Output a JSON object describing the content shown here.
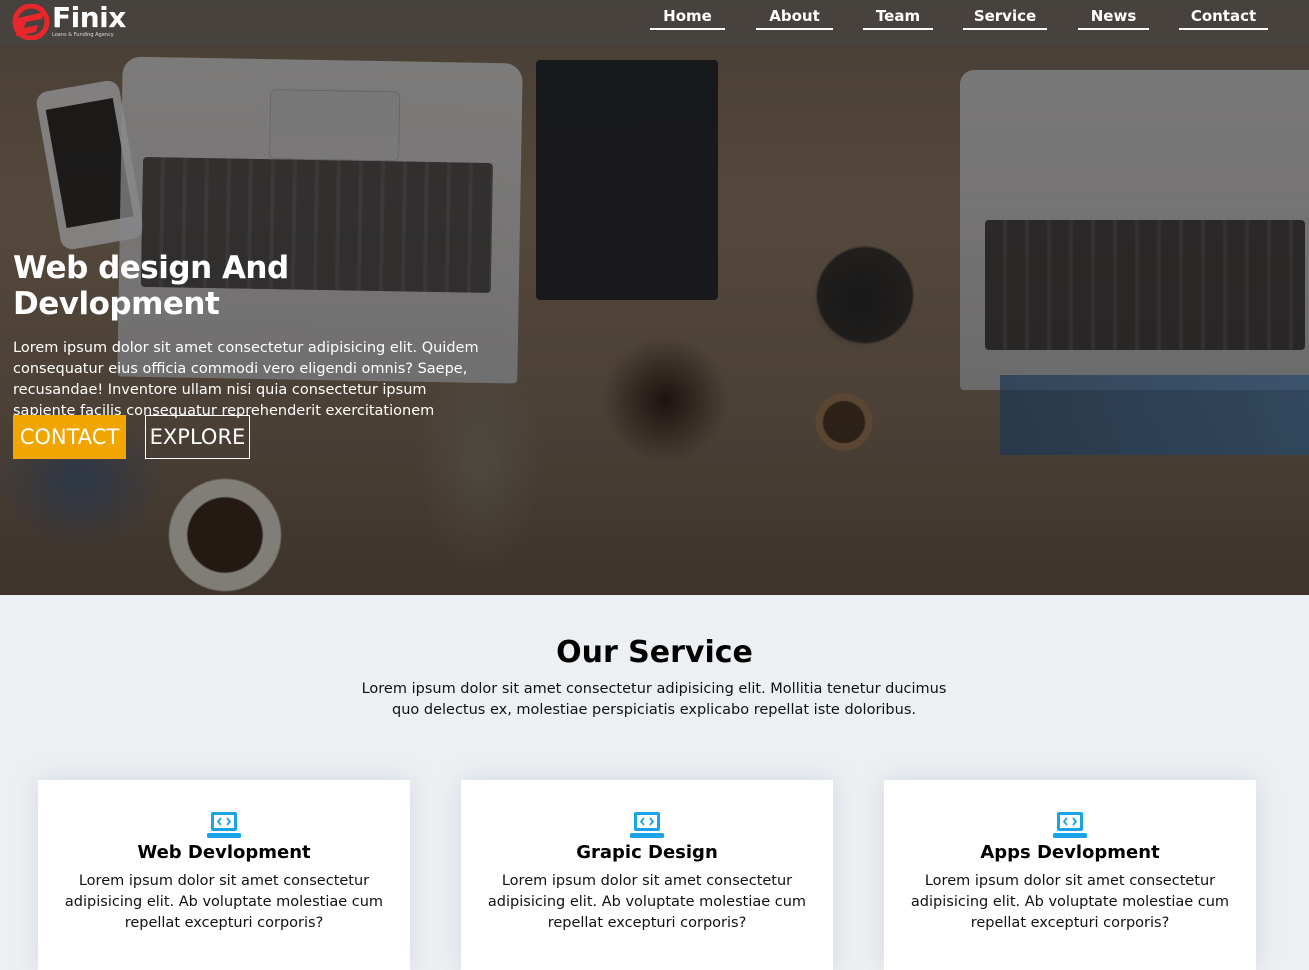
{
  "brand": {
    "name": "Finix",
    "tagline": "Loans & Funding Agency",
    "accent_color": "#e8262b"
  },
  "nav": {
    "items": [
      {
        "label": "Home"
      },
      {
        "label": "About"
      },
      {
        "label": "Team"
      },
      {
        "label": "Service"
      },
      {
        "label": "News"
      },
      {
        "label": "Contact"
      }
    ]
  },
  "hero": {
    "title": "Web design And Devlopment",
    "text": "Lorem ipsum dolor sit amet consectetur adipisicing elit. Quidem consequatur eius officia commodi vero eligendi omnis? Saepe, recusandae! Inventore ullam nisi quia consectetur ipsum sapiente facilis consequatur reprehenderit exercitationem voluptas.",
    "contact_label": "CONTACT",
    "explore_label": "EXPLORE",
    "contact_color": "#f0a500"
  },
  "service": {
    "title": "Our Service",
    "description": "Lorem ipsum dolor sit amet consectetur adipisicing elit. Mollitia tenetur ducimus quo delectus ex, molestiae perspiciatis explicabo repellat iste doloribus.",
    "icon": "laptop-code-icon",
    "icon_color": "#1aa3e8",
    "cards": [
      {
        "title": "Web Devlopment",
        "text": "Lorem ipsum dolor sit amet consectetur adipisicing elit. Ab voluptate molestiae cum repellat excepturi corporis?"
      },
      {
        "title": "Grapic Design",
        "text": "Lorem ipsum dolor sit amet consectetur adipisicing elit. Ab voluptate molestiae cum repellat excepturi corporis?"
      },
      {
        "title": "Apps Devlopment",
        "text": "Lorem ipsum dolor sit amet consectetur adipisicing elit. Ab voluptate molestiae cum repellat excepturi corporis?"
      }
    ]
  }
}
